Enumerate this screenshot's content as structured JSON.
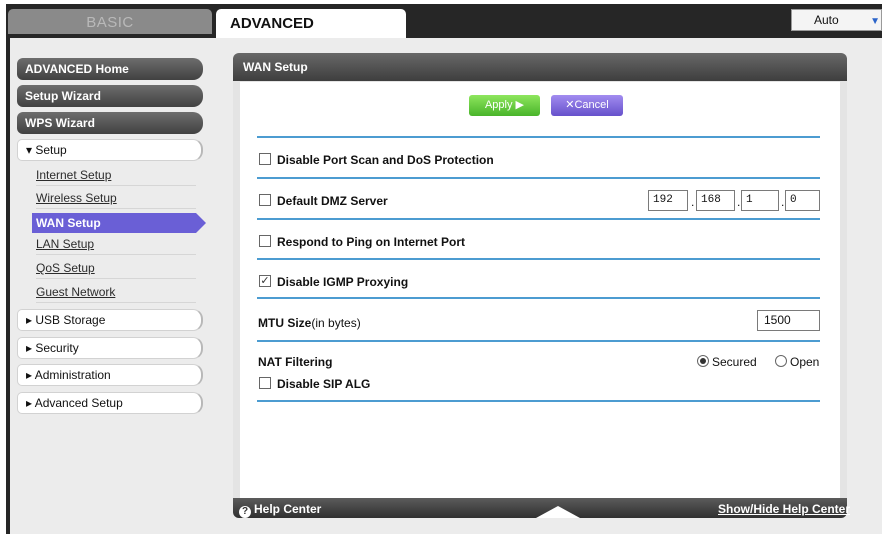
{
  "header": {
    "tabs": [
      {
        "label": "BASIC",
        "active": false
      },
      {
        "label": "ADVANCED",
        "active": true
      }
    ],
    "language": {
      "value": "Auto"
    }
  },
  "sidebar": {
    "buttons": [
      {
        "label": "ADVANCED Home"
      },
      {
        "label": "Setup Wizard"
      },
      {
        "label": "WPS Wizard"
      }
    ],
    "setup_group": {
      "label": "▾ Setup",
      "items": [
        {
          "label": "Internet Setup"
        },
        {
          "label": "Wireless Setup"
        },
        {
          "label": "WAN Setup",
          "active": true
        },
        {
          "label": "LAN Setup"
        },
        {
          "label": "QoS Setup"
        },
        {
          "label": "Guest Network"
        }
      ]
    },
    "groups": [
      {
        "label": "▸ USB Storage"
      },
      {
        "label": "▸ Security"
      },
      {
        "label": "▸ Administration"
      },
      {
        "label": "▸ Advanced Setup"
      }
    ]
  },
  "main": {
    "title": "WAN Setup",
    "apply_label": "Apply ▶",
    "cancel_label": "✕Cancel",
    "options": {
      "port_scan": {
        "label": "Disable Port Scan and DoS Protection",
        "checked": false
      },
      "dmz": {
        "label": "Default DMZ Server",
        "checked": false,
        "ip": [
          "192",
          "168",
          "1",
          "0"
        ]
      },
      "ping": {
        "label": "Respond to Ping on Internet Port",
        "checked": false
      },
      "igmp": {
        "label": "Disable IGMP Proxying",
        "checked": true
      },
      "sip": {
        "label": "Disable SIP ALG",
        "checked": false
      }
    },
    "mtu": {
      "label_bold": "MTU Size",
      "label_suffix": "(in bytes)",
      "value": "1500"
    },
    "nat": {
      "label": "NAT Filtering",
      "selected": "Secured",
      "options": [
        "Secured",
        "Open"
      ]
    }
  },
  "help": {
    "left_label": "Help Center",
    "right_label": "Show/Hide Help Center"
  },
  "colors": {
    "accent_purple": "#6a5fd6",
    "apply_green": "#5cc43a",
    "separator_blue": "#4c9cd1"
  }
}
